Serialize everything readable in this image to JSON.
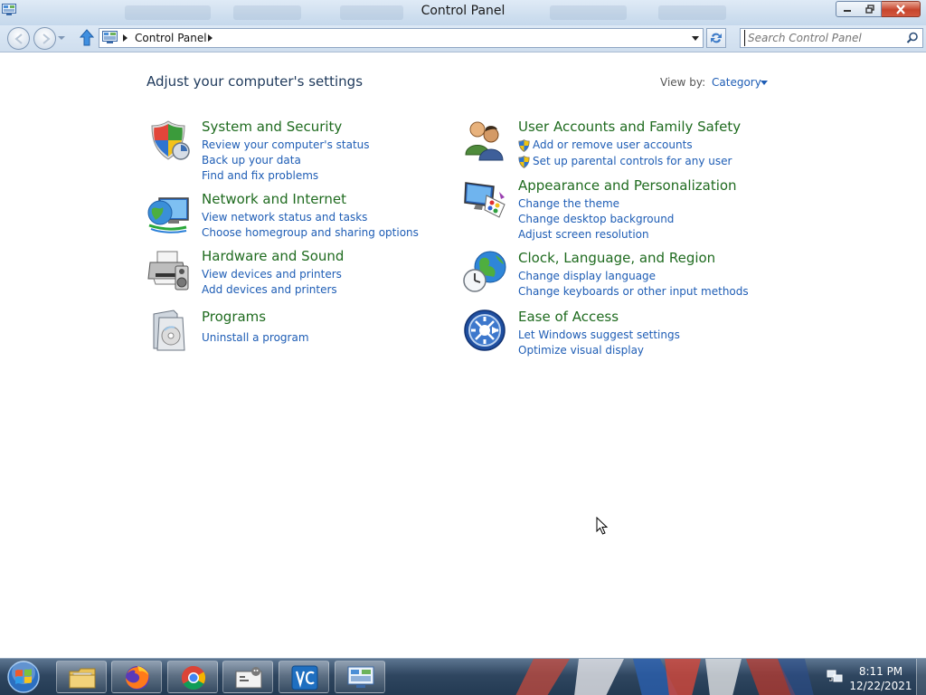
{
  "window": {
    "title": "Control Panel",
    "icons": {
      "app": "control-panel-icon",
      "minimize": "minimize-icon",
      "maximize": "maximize-icon",
      "close": "close-icon"
    }
  },
  "nav": {
    "address_crumb": "Control Panel",
    "search_placeholder": "Search Control Panel",
    "icons": {
      "back": "back-arrow-icon",
      "forward": "forward-arrow-icon",
      "up": "up-arrow-icon",
      "refresh": "refresh-icon",
      "search": "search-icon"
    }
  },
  "main": {
    "heading": "Adjust your computer's settings",
    "view_by_label": "View by:",
    "view_by_value": "Category",
    "categories_left": [
      {
        "title": "System and Security",
        "icon": "shield-icon",
        "links": [
          {
            "label": "Review your computer's status",
            "shield": false
          },
          {
            "label": "Back up your data",
            "shield": false
          },
          {
            "label": "Find and fix problems",
            "shield": false
          }
        ]
      },
      {
        "title": "Network and Internet",
        "icon": "network-globe-icon",
        "links": [
          {
            "label": "View network status and tasks",
            "shield": false
          },
          {
            "label": "Choose homegroup and sharing options",
            "shield": false
          }
        ]
      },
      {
        "title": "Hardware and Sound",
        "icon": "printer-speaker-icon",
        "links": [
          {
            "label": "View devices and printers",
            "shield": false
          },
          {
            "label": "Add devices and printers",
            "shield": false
          }
        ]
      },
      {
        "title": "Programs",
        "icon": "programs-icon",
        "links": [
          {
            "label": "Uninstall a program",
            "shield": false
          }
        ]
      }
    ],
    "categories_right": [
      {
        "title": "User Accounts and Family Safety",
        "icon": "users-icon",
        "links": [
          {
            "label": "Add or remove user accounts",
            "shield": true
          },
          {
            "label": "Set up parental controls for any user",
            "shield": true
          }
        ]
      },
      {
        "title": "Appearance and Personalization",
        "icon": "monitor-palette-icon",
        "links": [
          {
            "label": "Change the theme",
            "shield": false
          },
          {
            "label": "Change desktop background",
            "shield": false
          },
          {
            "label": "Adjust screen resolution",
            "shield": false
          }
        ]
      },
      {
        "title": "Clock, Language, and Region",
        "icon": "clock-globe-icon",
        "links": [
          {
            "label": "Change display language",
            "shield": false
          },
          {
            "label": "Change keyboards or other input methods",
            "shield": false
          }
        ]
      },
      {
        "title": "Ease of Access",
        "icon": "ease-of-access-icon",
        "links": [
          {
            "label": "Let Windows suggest settings",
            "shield": false
          },
          {
            "label": "Optimize visual display",
            "shield": false
          }
        ]
      }
    ]
  },
  "taskbar": {
    "buttons": [
      "start-orb-icon",
      "file-explorer-icon",
      "firefox-icon",
      "chrome-icon",
      "sniffer-icon",
      "vscode-icon",
      "control-panel-icon"
    ],
    "clock_time": "8:11 PM",
    "clock_date": "12/22/2021",
    "tray_icons": [
      "network-icon"
    ]
  },
  "colors": {
    "category_title": "#1f6b1f",
    "link": "#1e5db5",
    "heading": "#1e395b",
    "taskbar": "#2f4660"
  }
}
